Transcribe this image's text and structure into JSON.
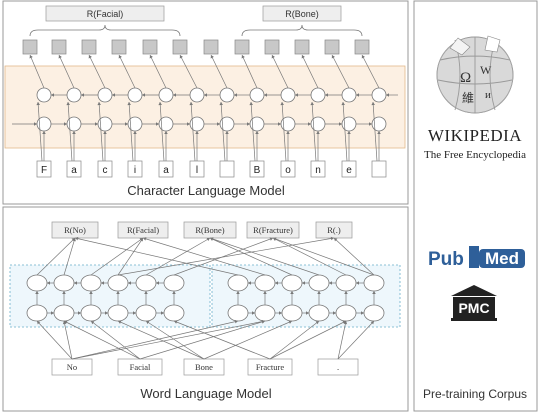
{
  "char_panel": {
    "caption": "Character Language Model",
    "brace_labels": [
      "R(Facial)",
      "R(Bone)"
    ],
    "input_chars": [
      "F",
      "a",
      "c",
      "i",
      "a",
      "l",
      "",
      "B",
      "o",
      "n",
      "e",
      ""
    ]
  },
  "word_panel": {
    "caption": "Word Language Model",
    "outputs": [
      "R(No)",
      "R(Facial)",
      "R(Bone)",
      "R(Fracture)",
      "R(.)"
    ],
    "inputs": [
      "No",
      "Facial",
      "Bone",
      "Fracture",
      "."
    ]
  },
  "corpus_panel": {
    "caption": "Pre-training Corpus",
    "wikipedia_wordmark": "Wikipedia",
    "wikipedia_tagline": "The Free Encyclopedia",
    "pubmed_pub": "Pub",
    "pubmed_med": "Med",
    "pmc": "PMC"
  },
  "colors": {
    "char_band": "#fcf0e3",
    "word_band": "#eef7fc",
    "pubmed_blue": "#2e5f99",
    "grey_box": "#c8c8c8",
    "label_box": "#eeeeee"
  }
}
